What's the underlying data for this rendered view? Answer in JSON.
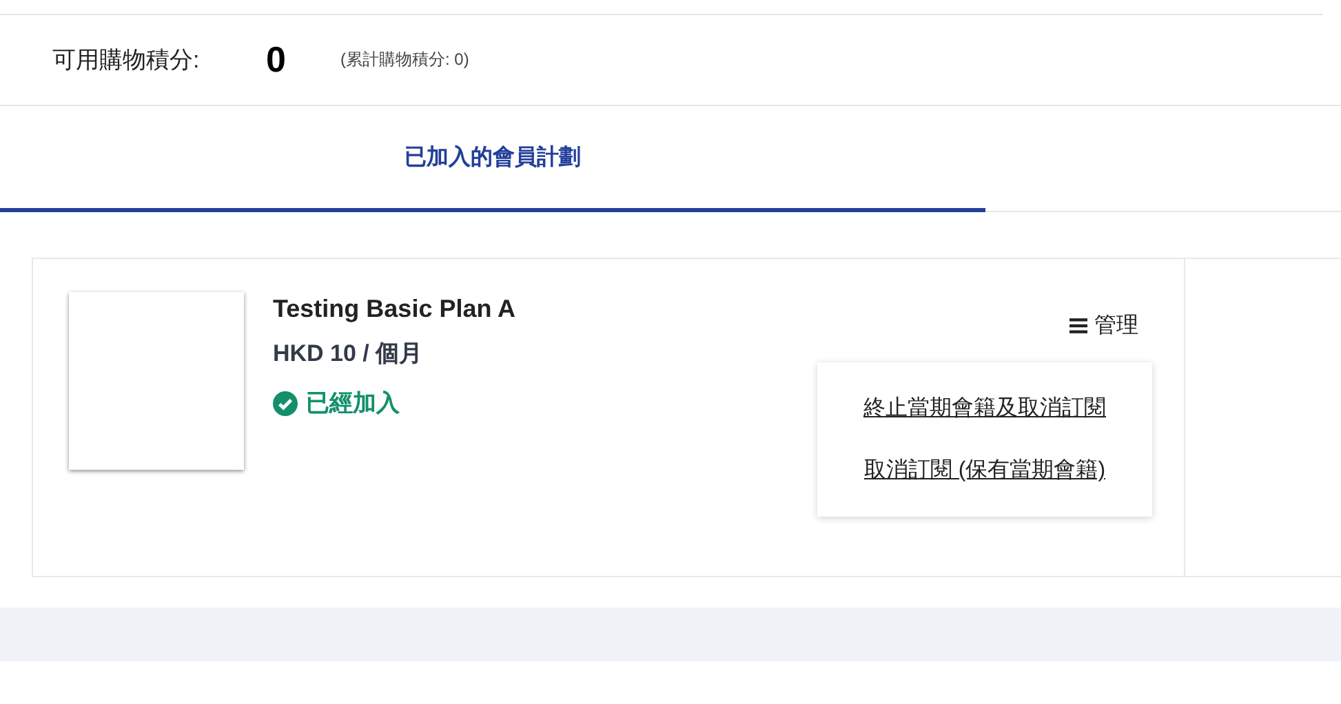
{
  "points": {
    "label": "可用購物積分:",
    "value": "0",
    "total": "(累計購物積分: 0)"
  },
  "tabs": [
    {
      "label": "已加入的會員計劃",
      "selected": true
    }
  ],
  "plans": [
    {
      "name": "Testing Basic Plan A",
      "price": "HKD 10 / 個月",
      "status": "已經加入",
      "joined": true,
      "manage": "管理",
      "menu": [
        "終止當期會籍及取消訂閱",
        "取消訂閱 (保有當期會籍)"
      ]
    }
  ]
}
